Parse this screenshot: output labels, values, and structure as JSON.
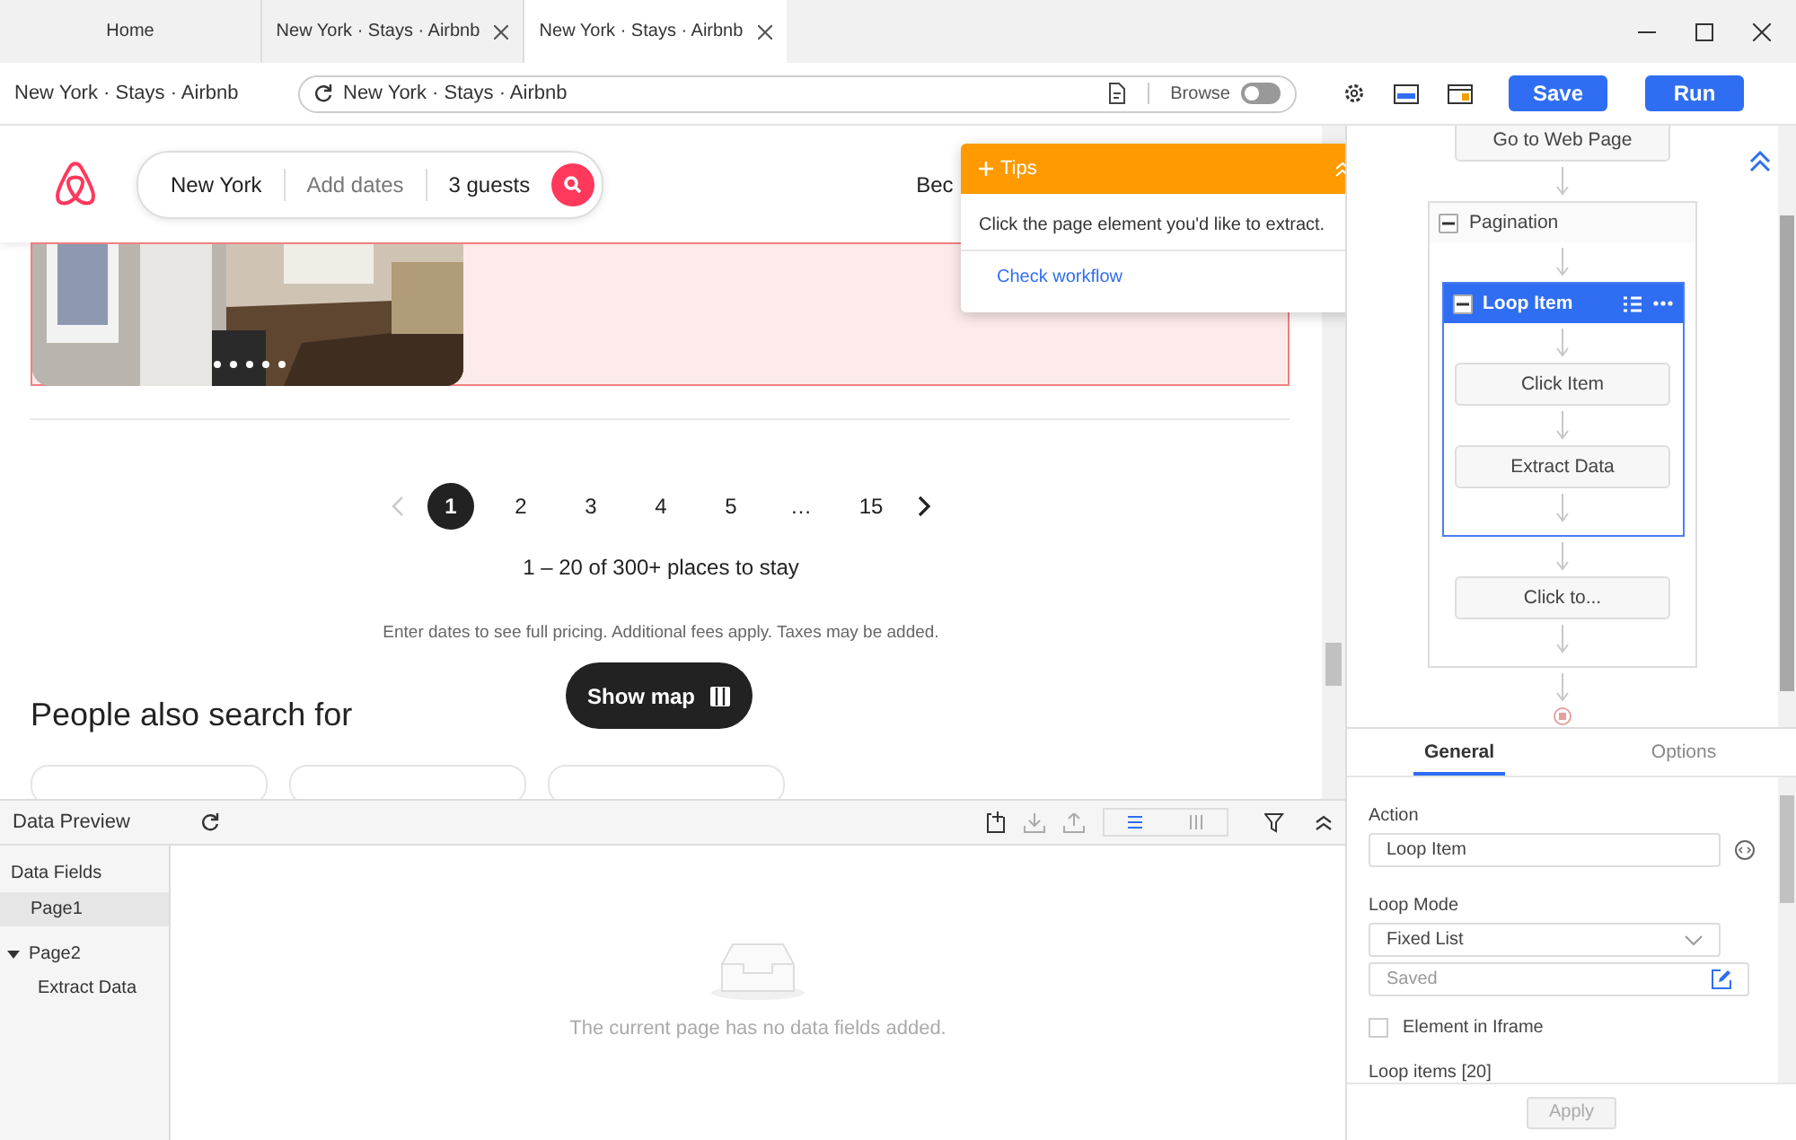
{
  "browser_tabs": [
    {
      "label": "Home",
      "selected": false,
      "closable": false
    },
    {
      "label": "New York · Stays · Airbnb",
      "selected": false,
      "closable": true
    },
    {
      "label": "New York · Stays · Airbnb",
      "selected": true,
      "closable": true
    }
  ],
  "toolbar": {
    "page_title": "New York · Stays · Airbnb",
    "address": "New York · Stays · Airbnb",
    "browse_label": "Browse",
    "browse_on": false,
    "buttons": [
      "Save",
      "Run"
    ]
  },
  "page": {
    "search": {
      "location": "New York",
      "dates": "Add dates",
      "guests": "3 guests"
    },
    "header_link": "Bec",
    "pagination": [
      {
        "label": "1",
        "selected": true
      },
      {
        "label": "2",
        "selected": false
      },
      {
        "label": "3",
        "selected": false
      },
      {
        "label": "4",
        "selected": false
      },
      {
        "label": "5",
        "selected": false
      },
      {
        "label": "…",
        "selected": false
      },
      {
        "label": "15",
        "selected": false
      }
    ],
    "summary": "1 – 20 of 300+ places to stay",
    "fine_print": "Enter dates to see full pricing. Additional fees apply. Taxes may be added.",
    "show_map": "Show map",
    "section_title": "People also search for"
  },
  "tips": {
    "title": "Tips",
    "message": "Click the page element you'd like to extract.",
    "link": "Check workflow"
  },
  "workflow": [
    {
      "kind": "action",
      "label": "Go to Web Page"
    },
    {
      "kind": "group",
      "label": "Pagination",
      "expanded": true,
      "selected": false,
      "children": [
        {
          "kind": "group",
          "label": "Loop Item",
          "expanded": true,
          "selected": true,
          "children": [
            {
              "kind": "action",
              "label": "Click Item"
            },
            {
              "kind": "action",
              "label": "Extract Data"
            }
          ]
        },
        {
          "kind": "action",
          "label": "Click to..."
        }
      ]
    }
  ],
  "properties": {
    "tabs": [
      {
        "label": "General",
        "selected": true
      },
      {
        "label": "Options",
        "selected": false
      }
    ],
    "action_label": "Action",
    "action_value": "Loop Item",
    "loop_mode_label": "Loop Mode",
    "loop_mode": "Fixed List",
    "list_value": "Saved",
    "iframe": {
      "label": "Element in Iframe",
      "checked": false
    },
    "loop_items_label": "Loop items [20]",
    "apply": "Apply"
  },
  "data_preview": {
    "title": "Data Preview",
    "fields_heading": "Data Fields",
    "pages": [
      {
        "label": "Page1",
        "selected": true
      },
      {
        "label": "Page2",
        "selected": false,
        "expanded": true,
        "children": [
          {
            "label": "Extract Data"
          }
        ]
      }
    ],
    "empty_message": "The current page has no data fields added."
  }
}
